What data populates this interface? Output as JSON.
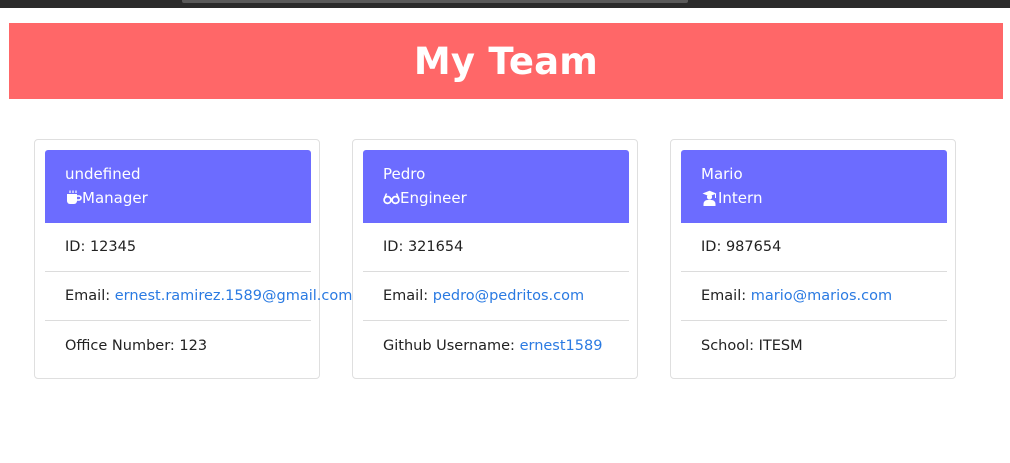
{
  "header": {
    "title": "My Team"
  },
  "colors": {
    "header_bg": "#ff6768",
    "card_head_bg": "#6c6cff",
    "link": "#2a7ae2"
  },
  "cards": [
    {
      "name": "undefined",
      "role": "Manager",
      "role_icon": "mug-icon",
      "id_label": "ID: ",
      "id_value": "12345",
      "email_label": "Email: ",
      "email_value": "ernest.ramirez.1589@gmail.com",
      "extra_label": "Office Number: ",
      "extra_value": "123"
    },
    {
      "name": "Pedro",
      "role": "Engineer",
      "role_icon": "glasses-icon",
      "id_label": "ID: ",
      "id_value": "321654",
      "email_label": "Email: ",
      "email_value": "pedro@pedritos.com",
      "extra_label": "Github Username: ",
      "extra_value": "ernest1589"
    },
    {
      "name": "Mario",
      "role": "Intern",
      "role_icon": "graduate-icon",
      "id_label": "ID: ",
      "id_value": "987654",
      "email_label": "Email: ",
      "email_value": "mario@marios.com",
      "extra_label": "School: ",
      "extra_value": "ITESM"
    }
  ]
}
